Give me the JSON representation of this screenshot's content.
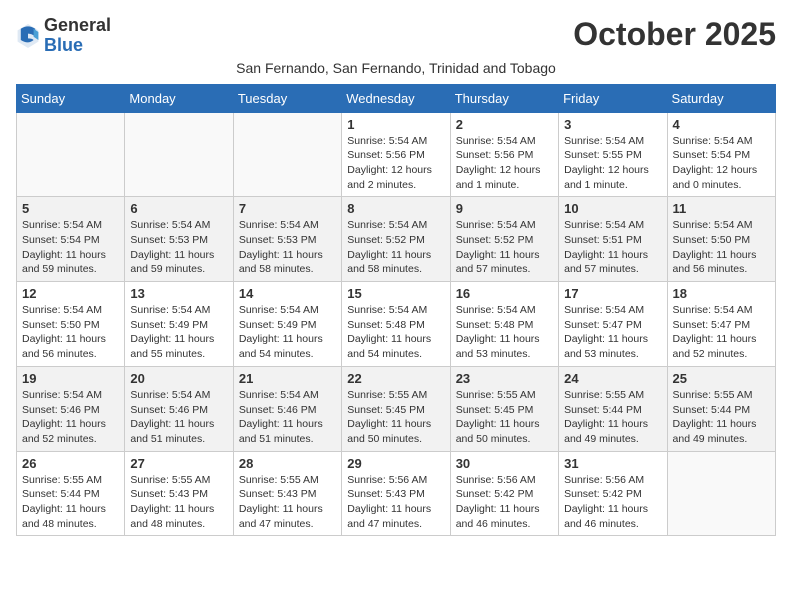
{
  "header": {
    "logo_general": "General",
    "logo_blue": "Blue",
    "month_title": "October 2025",
    "subtitle": "San Fernando, San Fernando, Trinidad and Tobago"
  },
  "days_of_week": [
    "Sunday",
    "Monday",
    "Tuesday",
    "Wednesday",
    "Thursday",
    "Friday",
    "Saturday"
  ],
  "weeks": [
    {
      "days": [
        {
          "number": "",
          "info": ""
        },
        {
          "number": "",
          "info": ""
        },
        {
          "number": "",
          "info": ""
        },
        {
          "number": "1",
          "sunrise": "Sunrise: 5:54 AM",
          "sunset": "Sunset: 5:56 PM",
          "daylight": "Daylight: 12 hours and 2 minutes."
        },
        {
          "number": "2",
          "sunrise": "Sunrise: 5:54 AM",
          "sunset": "Sunset: 5:56 PM",
          "daylight": "Daylight: 12 hours and 1 minute."
        },
        {
          "number": "3",
          "sunrise": "Sunrise: 5:54 AM",
          "sunset": "Sunset: 5:55 PM",
          "daylight": "Daylight: 12 hours and 1 minute."
        },
        {
          "number": "4",
          "sunrise": "Sunrise: 5:54 AM",
          "sunset": "Sunset: 5:54 PM",
          "daylight": "Daylight: 12 hours and 0 minutes."
        }
      ]
    },
    {
      "days": [
        {
          "number": "5",
          "sunrise": "Sunrise: 5:54 AM",
          "sunset": "Sunset: 5:54 PM",
          "daylight": "Daylight: 11 hours and 59 minutes."
        },
        {
          "number": "6",
          "sunrise": "Sunrise: 5:54 AM",
          "sunset": "Sunset: 5:53 PM",
          "daylight": "Daylight: 11 hours and 59 minutes."
        },
        {
          "number": "7",
          "sunrise": "Sunrise: 5:54 AM",
          "sunset": "Sunset: 5:53 PM",
          "daylight": "Daylight: 11 hours and 58 minutes."
        },
        {
          "number": "8",
          "sunrise": "Sunrise: 5:54 AM",
          "sunset": "Sunset: 5:52 PM",
          "daylight": "Daylight: 11 hours and 58 minutes."
        },
        {
          "number": "9",
          "sunrise": "Sunrise: 5:54 AM",
          "sunset": "Sunset: 5:52 PM",
          "daylight": "Daylight: 11 hours and 57 minutes."
        },
        {
          "number": "10",
          "sunrise": "Sunrise: 5:54 AM",
          "sunset": "Sunset: 5:51 PM",
          "daylight": "Daylight: 11 hours and 57 minutes."
        },
        {
          "number": "11",
          "sunrise": "Sunrise: 5:54 AM",
          "sunset": "Sunset: 5:50 PM",
          "daylight": "Daylight: 11 hours and 56 minutes."
        }
      ]
    },
    {
      "days": [
        {
          "number": "12",
          "sunrise": "Sunrise: 5:54 AM",
          "sunset": "Sunset: 5:50 PM",
          "daylight": "Daylight: 11 hours and 56 minutes."
        },
        {
          "number": "13",
          "sunrise": "Sunrise: 5:54 AM",
          "sunset": "Sunset: 5:49 PM",
          "daylight": "Daylight: 11 hours and 55 minutes."
        },
        {
          "number": "14",
          "sunrise": "Sunrise: 5:54 AM",
          "sunset": "Sunset: 5:49 PM",
          "daylight": "Daylight: 11 hours and 54 minutes."
        },
        {
          "number": "15",
          "sunrise": "Sunrise: 5:54 AM",
          "sunset": "Sunset: 5:48 PM",
          "daylight": "Daylight: 11 hours and 54 minutes."
        },
        {
          "number": "16",
          "sunrise": "Sunrise: 5:54 AM",
          "sunset": "Sunset: 5:48 PM",
          "daylight": "Daylight: 11 hours and 53 minutes."
        },
        {
          "number": "17",
          "sunrise": "Sunrise: 5:54 AM",
          "sunset": "Sunset: 5:47 PM",
          "daylight": "Daylight: 11 hours and 53 minutes."
        },
        {
          "number": "18",
          "sunrise": "Sunrise: 5:54 AM",
          "sunset": "Sunset: 5:47 PM",
          "daylight": "Daylight: 11 hours and 52 minutes."
        }
      ]
    },
    {
      "days": [
        {
          "number": "19",
          "sunrise": "Sunrise: 5:54 AM",
          "sunset": "Sunset: 5:46 PM",
          "daylight": "Daylight: 11 hours and 52 minutes."
        },
        {
          "number": "20",
          "sunrise": "Sunrise: 5:54 AM",
          "sunset": "Sunset: 5:46 PM",
          "daylight": "Daylight: 11 hours and 51 minutes."
        },
        {
          "number": "21",
          "sunrise": "Sunrise: 5:54 AM",
          "sunset": "Sunset: 5:46 PM",
          "daylight": "Daylight: 11 hours and 51 minutes."
        },
        {
          "number": "22",
          "sunrise": "Sunrise: 5:55 AM",
          "sunset": "Sunset: 5:45 PM",
          "daylight": "Daylight: 11 hours and 50 minutes."
        },
        {
          "number": "23",
          "sunrise": "Sunrise: 5:55 AM",
          "sunset": "Sunset: 5:45 PM",
          "daylight": "Daylight: 11 hours and 50 minutes."
        },
        {
          "number": "24",
          "sunrise": "Sunrise: 5:55 AM",
          "sunset": "Sunset: 5:44 PM",
          "daylight": "Daylight: 11 hours and 49 minutes."
        },
        {
          "number": "25",
          "sunrise": "Sunrise: 5:55 AM",
          "sunset": "Sunset: 5:44 PM",
          "daylight": "Daylight: 11 hours and 49 minutes."
        }
      ]
    },
    {
      "days": [
        {
          "number": "26",
          "sunrise": "Sunrise: 5:55 AM",
          "sunset": "Sunset: 5:44 PM",
          "daylight": "Daylight: 11 hours and 48 minutes."
        },
        {
          "number": "27",
          "sunrise": "Sunrise: 5:55 AM",
          "sunset": "Sunset: 5:43 PM",
          "daylight": "Daylight: 11 hours and 48 minutes."
        },
        {
          "number": "28",
          "sunrise": "Sunrise: 5:55 AM",
          "sunset": "Sunset: 5:43 PM",
          "daylight": "Daylight: 11 hours and 47 minutes."
        },
        {
          "number": "29",
          "sunrise": "Sunrise: 5:56 AM",
          "sunset": "Sunset: 5:43 PM",
          "daylight": "Daylight: 11 hours and 47 minutes."
        },
        {
          "number": "30",
          "sunrise": "Sunrise: 5:56 AM",
          "sunset": "Sunset: 5:42 PM",
          "daylight": "Daylight: 11 hours and 46 minutes."
        },
        {
          "number": "31",
          "sunrise": "Sunrise: 5:56 AM",
          "sunset": "Sunset: 5:42 PM",
          "daylight": "Daylight: 11 hours and 46 minutes."
        },
        {
          "number": "",
          "info": ""
        }
      ]
    }
  ]
}
